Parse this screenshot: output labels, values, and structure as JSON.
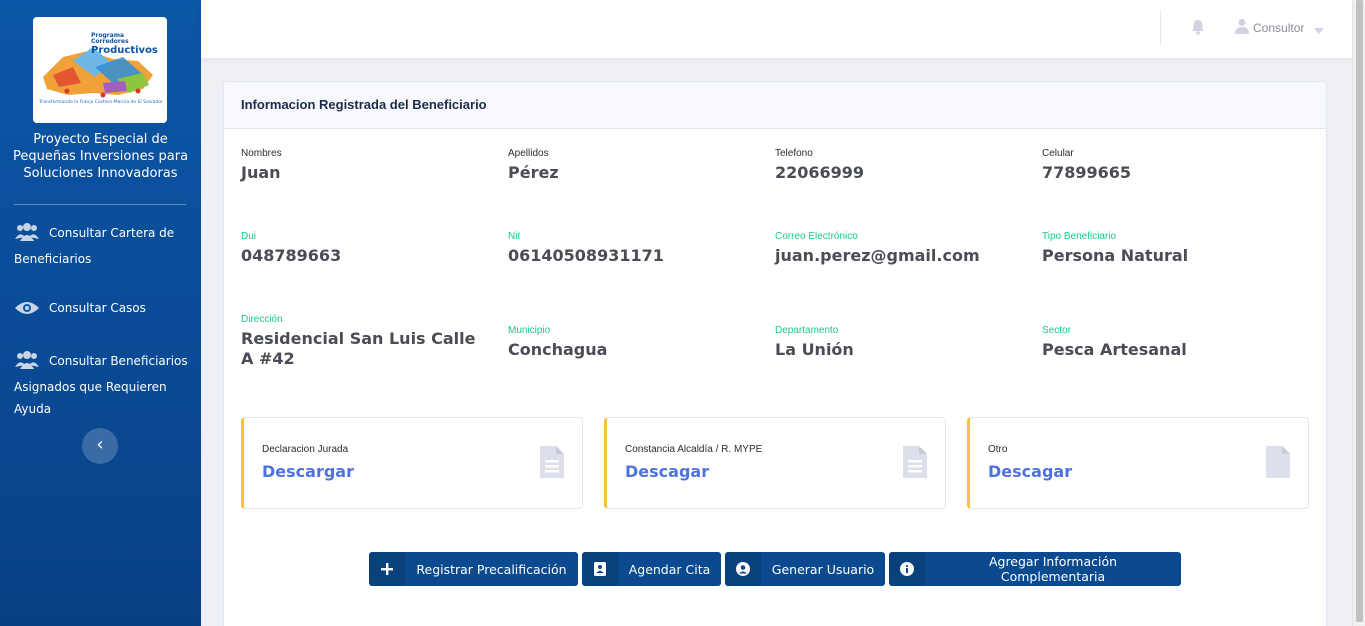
{
  "sidebar": {
    "logo": {
      "program": "Programa",
      "line1": "Corredores",
      "line2": "Productivos",
      "tagline": "Transformando la Franja Costero-Marina de El Salvador"
    },
    "brand": "Proyecto Especial de Pequeñas Inversiones para Soluciones Innovadoras",
    "items": [
      {
        "label": "Consultar Cartera de Beneficiarios",
        "icon": "users-icon"
      },
      {
        "label": "Consultar Casos",
        "icon": "eye-icon"
      },
      {
        "label": "Consultar Beneficiarios Asignados que Requieren Ayuda",
        "icon": "users-icon"
      }
    ],
    "collapse_icon": "chevron-left-icon"
  },
  "topbar": {
    "user_name": "Consultor",
    "icons": [
      "bell-icon",
      "user-icon",
      "caret-down-icon"
    ]
  },
  "card": {
    "title": "Informacion Registrada del Beneficiario",
    "fields": [
      {
        "label": "Nombres",
        "value": "Juan"
      },
      {
        "label": "Apellidos",
        "value": "Pérez"
      },
      {
        "label": "Telefono",
        "value": "22066999"
      },
      {
        "label": "Celular",
        "value": "77899665"
      },
      {
        "label": "Dui",
        "value": "048789663"
      },
      {
        "label": "Nit",
        "value": "06140508931171"
      },
      {
        "label": "Correo Electrónico",
        "value": "juan.perez@gmail.com"
      },
      {
        "label": "Tipo Beneficiario",
        "value": "Persona Natural"
      },
      {
        "label": "Dirección",
        "value": "Residencial San Luis Calle A #42"
      },
      {
        "label": "Municipio",
        "value": "Conchagua"
      },
      {
        "label": "Departamento",
        "value": "La Unión"
      },
      {
        "label": "Sector",
        "value": "Pesca Artesanal"
      }
    ],
    "documents": [
      {
        "label": "Declaracion Jurada",
        "link": "Descargar",
        "icon": "file-text-icon"
      },
      {
        "label": "Constancia Alcaldía / R. MYPE",
        "link": "Descagar",
        "icon": "file-text-icon"
      },
      {
        "label": "Otro",
        "link": "Descagar",
        "icon": "file-icon"
      }
    ],
    "buttons": [
      {
        "label": "Registrar Precalificación",
        "icon": "plus-icon"
      },
      {
        "label": "Agendar Cita",
        "icon": "address-book-icon"
      },
      {
        "label": "Generar Usuario",
        "icon": "user-circle-icon"
      },
      {
        "label": "Agregar Información Complementaria",
        "icon": "info-circle-icon"
      }
    ]
  },
  "colors": {
    "sidebar": "#0b56a6",
    "primary_button": "#0b4a8f",
    "link": "#4e73df",
    "doc_accent": "#f6c23e",
    "label_teal": "#1cc88a"
  }
}
